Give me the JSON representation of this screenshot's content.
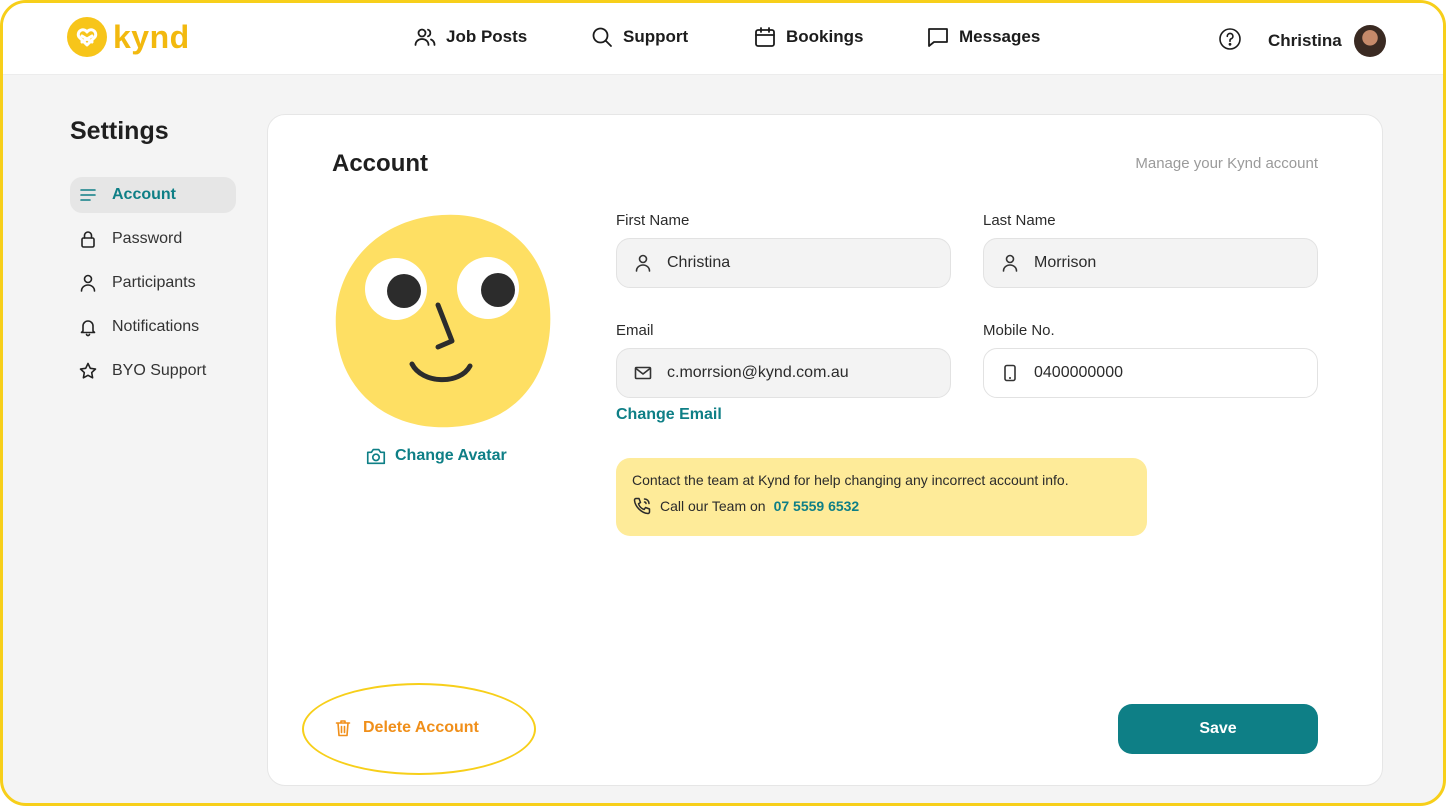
{
  "header": {
    "logo_text": "kynd",
    "nav": [
      {
        "label": "Job Posts",
        "icon": "users-icon"
      },
      {
        "label": "Support",
        "icon": "search-icon"
      },
      {
        "label": "Bookings",
        "icon": "calendar-icon"
      },
      {
        "label": "Messages",
        "icon": "chat-icon"
      }
    ],
    "user_name": "Christina"
  },
  "sidebar": {
    "title": "Settings",
    "items": [
      {
        "label": "Account",
        "icon": "menu-lines-icon",
        "active": true
      },
      {
        "label": "Password",
        "icon": "lock-icon"
      },
      {
        "label": "Participants",
        "icon": "person-icon"
      },
      {
        "label": "Notifications",
        "icon": "bell-icon"
      },
      {
        "label": "BYO Support",
        "icon": "star-icon"
      }
    ]
  },
  "account": {
    "title": "Account",
    "subtitle": "Manage your Kynd account",
    "change_avatar": "Change Avatar",
    "first_name_label": "First Name",
    "first_name": "Christina",
    "last_name_label": "Last Name",
    "last_name": "Morrison",
    "email_label": "Email",
    "email": "c.morrsion@kynd.com.au",
    "mobile_label": "Mobile No.",
    "mobile": "0400000000",
    "change_email": "Change Email",
    "notice_text": "Contact the team at Kynd for help changing any incorrect account info.",
    "notice_call_prefix": "Call our Team on",
    "notice_phone": "07 5559 6532",
    "delete_label": "Delete Account",
    "save_label": "Save"
  },
  "colors": {
    "accent": "#0e7f86",
    "brand_yellow": "#f7c51a",
    "danger": "#f08f1a",
    "notice_bg": "#feeb99"
  }
}
